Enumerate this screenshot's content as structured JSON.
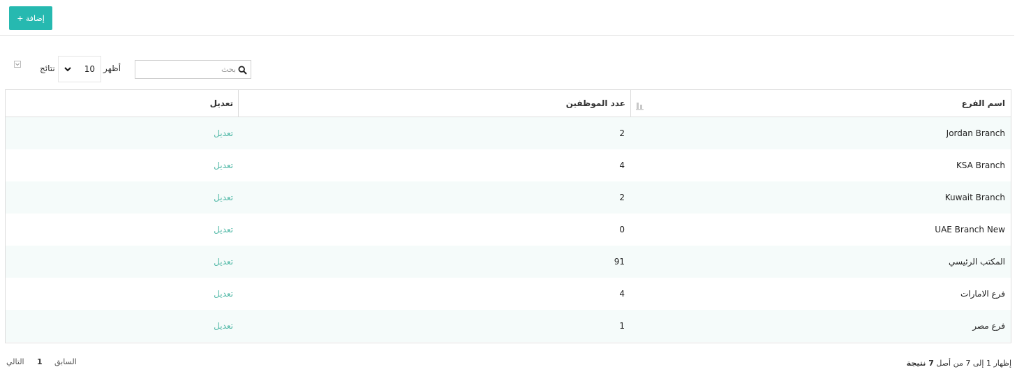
{
  "toolbar": {
    "add_label": "+ إضافة"
  },
  "controls": {
    "show_label": "أظهر",
    "page_size": "10",
    "results_label": "نتائج",
    "search_placeholder": "بحث",
    "export_icon": "sort-down-icon"
  },
  "table": {
    "headers": {
      "branch_name": "اسم الفرع",
      "employee_count": "عدد الموظفين",
      "edit": "تعديل"
    },
    "rows": [
      {
        "name": "Jordan Branch",
        "count": "2",
        "edit": "تعديل"
      },
      {
        "name": "KSA Branch",
        "count": "4",
        "edit": "تعديل"
      },
      {
        "name": "Kuwait Branch",
        "count": "2",
        "edit": "تعديل"
      },
      {
        "name": "UAE Branch New",
        "count": "0",
        "edit": "تعديل"
      },
      {
        "name": "المكتب الرئيسي",
        "count": "91",
        "edit": "تعديل"
      },
      {
        "name": "فرع الامارات",
        "count": "4",
        "edit": "تعديل"
      },
      {
        "name": "فرع مصر",
        "count": "1",
        "edit": "تعديل"
      }
    ]
  },
  "footer": {
    "info_prefix": "إظهار 1 إلى 7 من أصل",
    "info_total": "7 نتيجة",
    "previous": "السابق",
    "page": "1",
    "next": "التالي"
  },
  "colors": {
    "accent": "#26b9b0",
    "link": "#4fb8a6",
    "row_alt": "#f5fbfa"
  }
}
